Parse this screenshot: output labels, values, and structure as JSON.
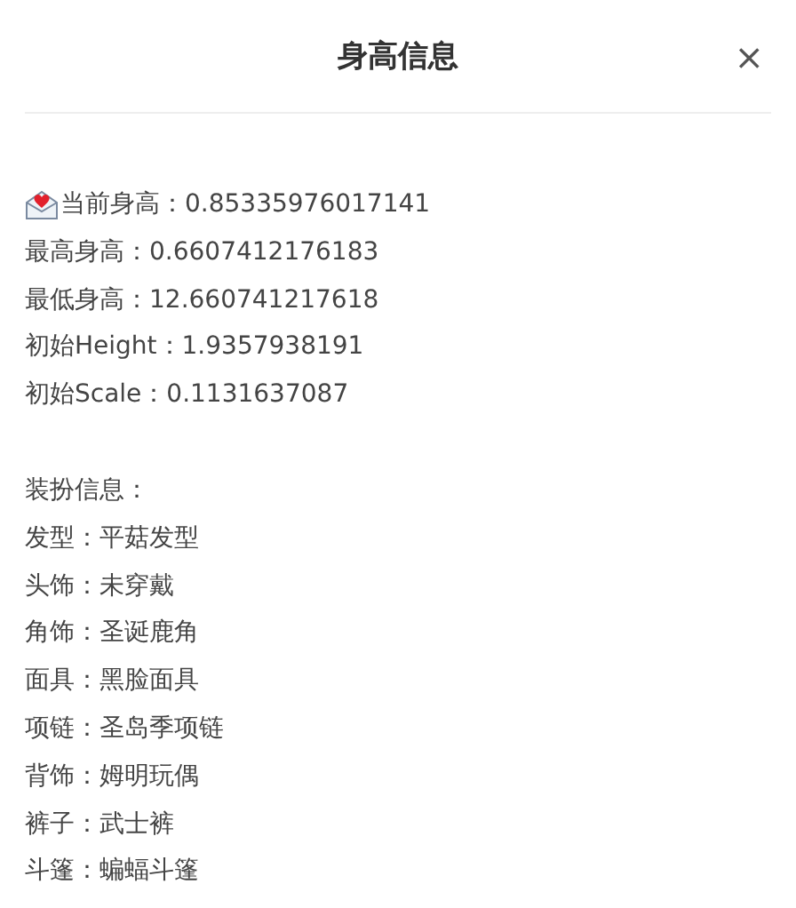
{
  "dialog": {
    "title": "身高信息",
    "close": "×"
  },
  "height_lines": [
    "当前身高：0.85335976017141",
    "最高身高：0.6607412176183",
    "最低身高：12.660741217618",
    "初始Height：1.9357938191",
    "初始Scale：0.1131637087"
  ],
  "outfit": {
    "heading": "装扮信息：",
    "items": [
      "发型：平菇发型",
      "头饰：未穿戴",
      "角饰：圣诞鹿角",
      "面具：黑脸面具",
      "项链：圣岛季项链",
      "背饰：姆明玩偶",
      "裤子：武士裤",
      "斗篷：蝙蝠斗篷"
    ]
  }
}
